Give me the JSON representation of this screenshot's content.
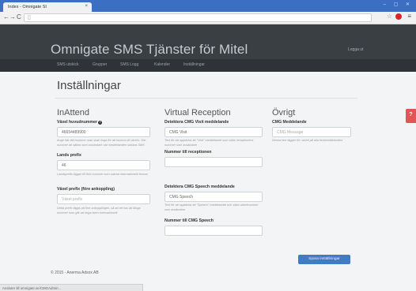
{
  "browser": {
    "tab_title": "Index - Omnigate SI",
    "tab_close": "×",
    "url": "",
    "status_text": "Ansluter till omnigate.se/CMGAdmin..."
  },
  "header": {
    "brand": "Omnigate SMS Tjänster för Mitel",
    "login": "Logga ut"
  },
  "nav": {
    "items": [
      "SMS utskick",
      "Grupper",
      "SMS Logg",
      "Kalender",
      "Inställningar"
    ]
  },
  "page": {
    "title": "Inställningar"
  },
  "inattend": {
    "title": "InAttend",
    "main_number_label": "Växel huvudnummer",
    "main_number_value": "46654489900",
    "main_number_help": "Ange här det nummer man skall ringa för att komma till växeln. Det nummer att sättas som avsändare när meddelanden skickas SMS",
    "country_prefix_label": "Lands prefix",
    "country_prefix_value": "46",
    "country_prefix_help": "Landsprefix lägger till före nummer som saknar internationellt format",
    "switch_prefix_label": "Växel prefix (före ankoppling)",
    "switch_prefix_placeholder": "Växel prefix",
    "switch_prefix_help": "Detta prefix läggs på före ankopplingen, så att det tas att länga nummer som går att ringa även internationellt"
  },
  "virtual": {
    "title": "Virtual Reception",
    "visit_label": "Detektera CMG Visit meddelande",
    "visit_value": "CMG Visit",
    "visit_help": "Text för att upptäcka ett \"Visit\" meddelande som sätts receptionens nummer som avsändare",
    "reception_number_label": "Nummer till receptionen",
    "reception_number_value": "",
    "speech_label": "Detektera CMG Speech meddelande",
    "speech_value": "CMG Speech",
    "speech_help": "Text för att upptäcka ett \"Speech\" meddelande och sätta växelnummer som avsändare",
    "speech_number_label": "Nummer till CMG Speech",
    "speech_number_value": ""
  },
  "other": {
    "title": "Övrigt",
    "cmg_message_label": "CMG Meddelande",
    "cmg_message_placeholder": "CMG Message",
    "cmg_message_help": "Denna text lägger till i slutet på alla textmeddelanden"
  },
  "actions": {
    "save": "Spara inställningar"
  },
  "footer": {
    "text": "© 2015 - Anerma Adsox AB"
  },
  "widgets": {
    "help": "?"
  }
}
